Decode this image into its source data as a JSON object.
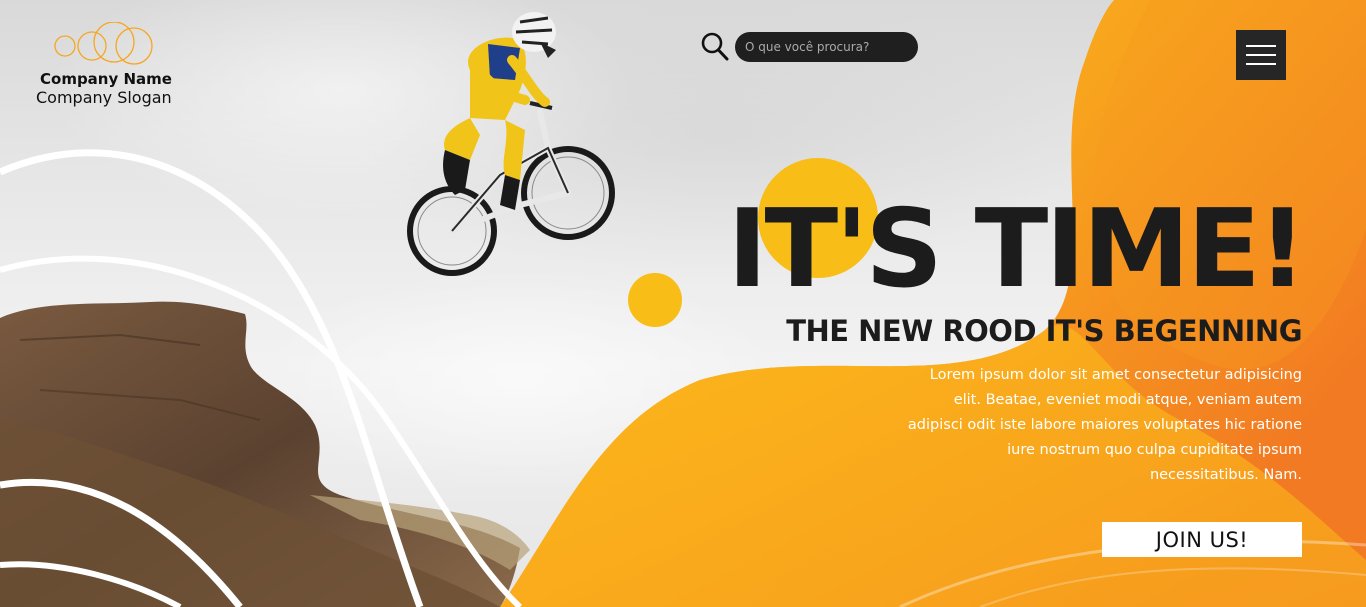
{
  "brand": {
    "company_name": "Company Name",
    "company_slogan": "Company Slogan",
    "accent_color": "#f7b518",
    "accent_dark": "#f27b22"
  },
  "search": {
    "placeholder": "O que você procura?",
    "icon": "search-icon"
  },
  "nav": {
    "menu_icon": "hamburger-icon"
  },
  "hero": {
    "headline": "IT'S TIME!",
    "subheadline": "THE NEW ROOD IT'S BEGENNING",
    "body": "Lorem ipsum dolor sit amet consectetur adipisicing elit. Beatae, eveniet modi atque, veniam autem adipisci odit iste labore maiores voluptates hic ratione iure nostrum quo culpa cupiditate ipsum necessitatibus. Nam.",
    "cta_label": "JOIN US!"
  }
}
